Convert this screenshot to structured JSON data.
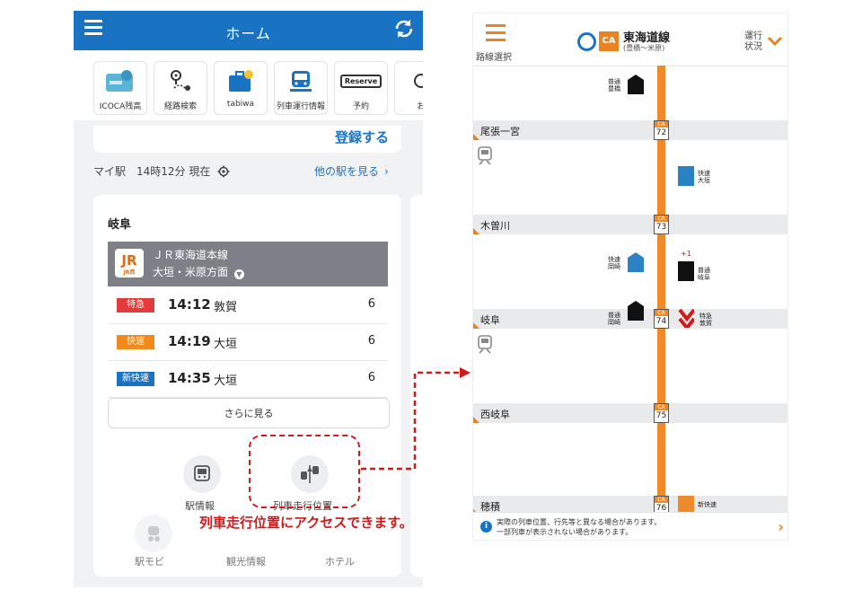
{
  "app": {
    "home_title": "ホーム"
  },
  "shortcuts": [
    {
      "label": "ICOCA残高",
      "icon": "icoca-card-icon"
    },
    {
      "label": "経路検索",
      "icon": "route-search-icon"
    },
    {
      "label": "tabiwa",
      "icon": "tabiwa-icon"
    },
    {
      "label": "列車運行情報",
      "icon": "train-operation-icon"
    },
    {
      "label": "予約",
      "icon": "reserve-icon"
    },
    {
      "label": "お",
      "icon": "more-shortcut-icon"
    }
  ],
  "reserve_sign": "Reserve",
  "register_label": "登録する",
  "my_station": {
    "label": "マイ駅　14時12分 現在",
    "other_link": "他の駅を見る"
  },
  "station_card": {
    "station": "岐阜",
    "logo_jr": "JR",
    "logo_sub": "JR西",
    "line_name": "ＪＲ東海道本線",
    "direction": "大垣・米原方面",
    "trains": [
      {
        "type": "特急",
        "color": "#e33b3b",
        "time": "14:12",
        "dest": "敦賀",
        "platform": "6"
      },
      {
        "type": "快速",
        "color": "#f08a1c",
        "time": "14:19",
        "dest": "大垣",
        "platform": "6"
      },
      {
        "type": "新快速",
        "color": "#1a73c2",
        "time": "14:35",
        "dest": "大垣",
        "platform": "6"
      }
    ],
    "more_label": "さらに見る",
    "buttons": [
      {
        "label": "駅情報",
        "icon": "station-info-icon"
      },
      {
        "label": "列車走行位置",
        "icon": "train-position-icon"
      }
    ],
    "bottom_items": [
      {
        "label": "駅モビ",
        "icon": "ekimobi-icon"
      },
      {
        "label": "観光情報"
      },
      {
        "label": "ホテル"
      }
    ]
  },
  "callout": "列車走行位置にアクセスできます。",
  "right": {
    "route_select": "路線選択",
    "line_code": "CA",
    "line_title": "東海道線",
    "line_range": "(豊橋～米原)",
    "status_label": "運行状況",
    "stations": [
      {
        "name": "尾張一宮",
        "no": "72"
      },
      {
        "name": "木曽川",
        "no": "73"
      },
      {
        "name": "岐阜",
        "no": "74"
      },
      {
        "name": "西岐阜",
        "no": "75"
      },
      {
        "name": "穂積",
        "no": "76"
      }
    ],
    "trains": [
      {
        "kind": "普通",
        "dest": "豊橋"
      },
      {
        "kind": "快速",
        "dest": "大垣"
      },
      {
        "kind": "快速",
        "dest": "岡崎"
      },
      {
        "kind": "普通",
        "dest": "岐阜",
        "delay": "+1"
      },
      {
        "kind": "普通",
        "dest": "岡崎"
      },
      {
        "kind": "特急",
        "dest": "敦賀"
      },
      {
        "kind": "新快速",
        "dest": ""
      }
    ],
    "notice1": "実際の列車位置、行先等と異なる場合があります。",
    "notice2": "一部列車が表示されない場合があります。"
  },
  "colors": {
    "blue": "#1a73c2",
    "orange": "#ef8a2a",
    "red": "#d11a1a"
  }
}
